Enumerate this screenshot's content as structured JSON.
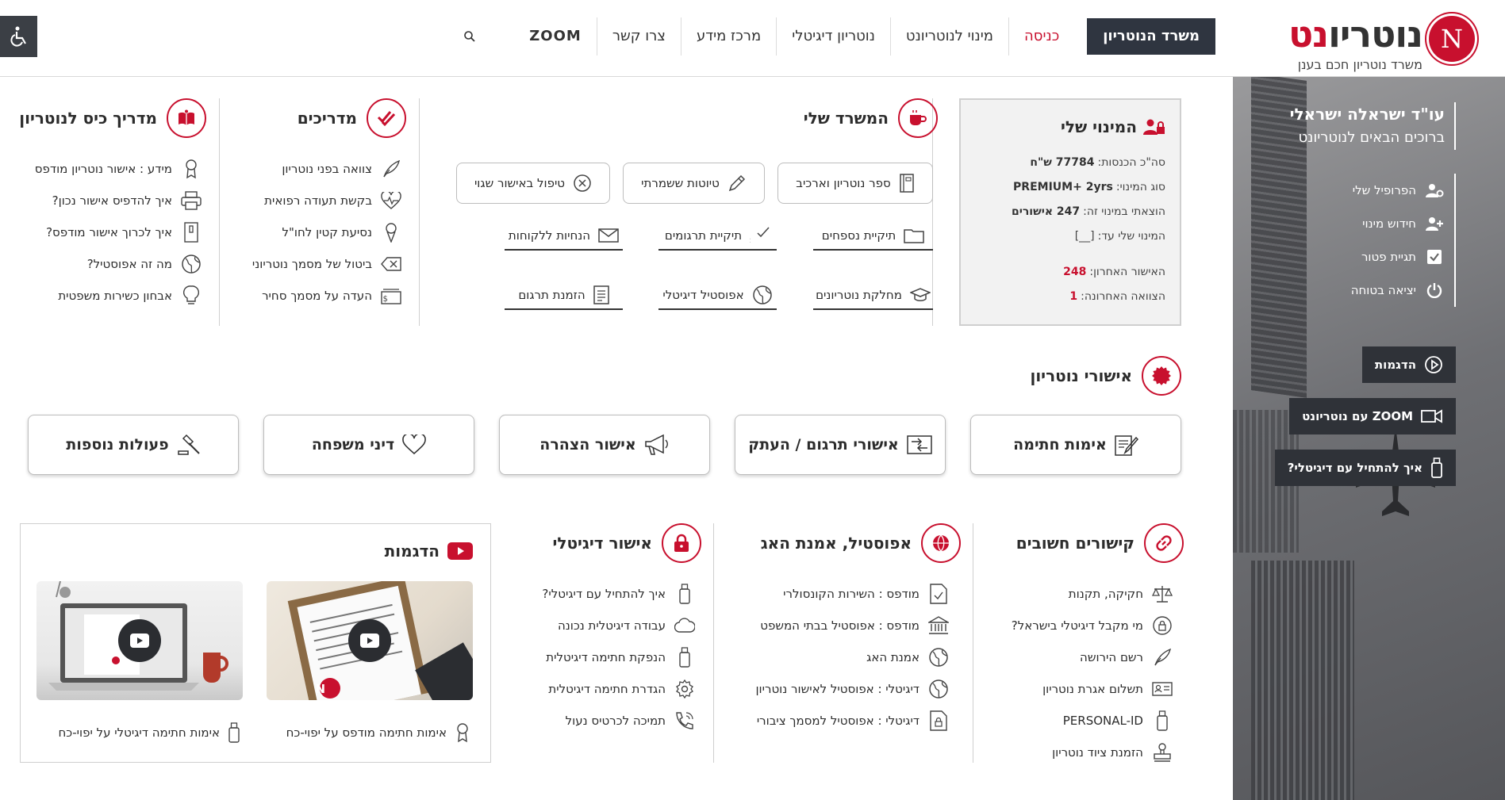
{
  "brand": {
    "logo_letter": "N",
    "logo_word_dark": "נוטריו",
    "logo_word_red": "נט",
    "tagline": "משרד נוטריון חכם בענן",
    "accent": "#c8102e",
    "dark": "#2f3540"
  },
  "nav": {
    "primary": "משרד הנוטריון",
    "login": "כניסה",
    "appointment": "מינוי לנוטריונט",
    "digital": "נוטריון דיגיטלי",
    "info": "מרכז מידע",
    "contact": "צרו קשר",
    "zoom": "ZOOM"
  },
  "sidebar": {
    "name": "עו\"ד ישראלה ישראלי",
    "welcome": "ברוכים הבאים לנוטריונט",
    "links": [
      "הפרופיל שלי",
      "חידוש מינוי",
      "תגיית פטור",
      "יציאה בטוחה"
    ],
    "buttons": [
      "הדגמות",
      "ZOOM עם נוטריונט",
      "איך להתחיל עם דיגיטלי?"
    ]
  },
  "appointment": {
    "title": "המינוי שלי",
    "rows": [
      {
        "label": "סה\"כ הכנסות:",
        "value": "77784 ש\"ח"
      },
      {
        "label": "סוג המינוי:",
        "value": "PREMIUM+ 2yrs"
      },
      {
        "label": "הוצאתי במינוי זה:",
        "value": "247 אישורים"
      },
      {
        "label": "המינוי שלי עד:",
        "value": "[__]"
      },
      {
        "label": "האישור האחרון:",
        "value": "248"
      },
      {
        "label": "הצוואה האחרונה:",
        "value": "1"
      }
    ]
  },
  "office": {
    "title": "המשרד שלי",
    "buttons": [
      "ספר נוטריון וארכיב",
      "טיוטות ששמרתי",
      "טיפול באישור שגוי"
    ],
    "links_row1": [
      "תיקיית נספחים",
      "תיקיית תרגומים",
      "הנחיות ללקוחות"
    ],
    "links_row2": [
      "מחלקת נוטריונים",
      "אפוסטיל דיגיטלי",
      "הזמנת תרגום"
    ]
  },
  "guides": {
    "title": "מדריכים",
    "items": [
      "צוואה בפני נוטריון",
      "בקשת תעודה רפואית",
      "נסיעת קטין לחו\"ל",
      "ביטול של מסמך נוטריוני",
      "העדה על מסמך סחיר"
    ]
  },
  "pocket": {
    "title": "מדריך כיס לנוטריון",
    "items": [
      "מידע : אישור נוטריון מודפס",
      "איך להדפיס אישור נכון?",
      "איך לכרוך אישור מודפס?",
      "מה זה אפוסטיל?",
      "אבחון כשירות משפטית"
    ]
  },
  "approvals": {
    "title": "אישורי נוטריון",
    "cards": [
      "אימות חתימה",
      "אישורי תרגום / העתק",
      "אישור הצהרה",
      "דיני משפחה",
      "פעולות נוספות"
    ]
  },
  "links": {
    "title": "קישורים חשובים",
    "items": [
      "חקיקה, תקנות",
      "מי מקבל דיגיטלי בישראל?",
      "רשם הירושה",
      "תשלום אגרת נוטריון",
      "PERSONAL-ID",
      "הזמנת ציוד נוטריון"
    ]
  },
  "apostille": {
    "title": "אפוסטיל, אמנת האג",
    "items": [
      "מודפס : השירות הקונסולרי",
      "מודפס : אפוסטיל בבתי המשפט",
      "אמנת האג",
      "דיגיטלי : אפוסטיל לאישור נוטריון",
      "דיגיטלי : אפוסטיל למסמך ציבורי"
    ]
  },
  "digital": {
    "title": "אישור דיגיטלי",
    "items": [
      "איך להתחיל עם דיגיטלי?",
      "עבודה דיגיטלית נכונה",
      "הנפקת חתימה דיגיטלית",
      "הגדרת חתימה דיגיטלית",
      "תמיכה לכרטיס נעול"
    ]
  },
  "demos": {
    "title": "הדגמות",
    "captions": [
      "אימות חתימה מודפס על יפוי-כח",
      "אימות חתימה דיגיטלי על יפוי-כח"
    ]
  }
}
